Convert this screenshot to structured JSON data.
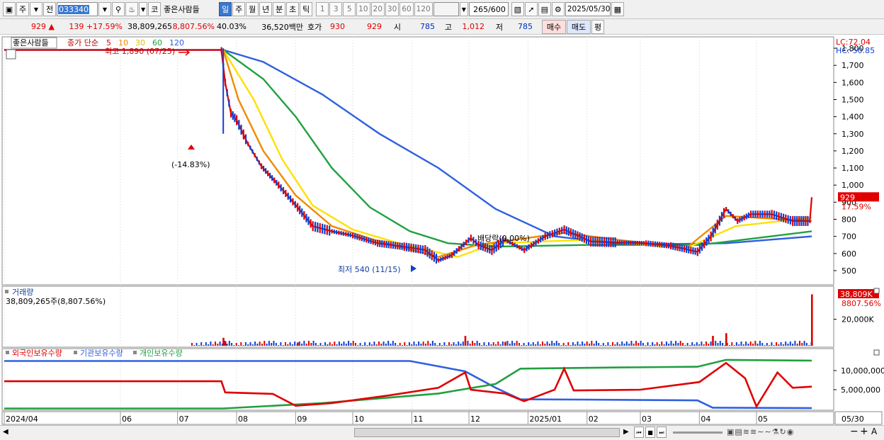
{
  "toolbar": {
    "market_label": "주",
    "prev_label": "전",
    "code": "033340",
    "market_tag": "코",
    "stock_name": "좋은사람들",
    "periods": [
      "일",
      "주",
      "월",
      "년",
      "분",
      "초",
      "틱"
    ],
    "active_period": "일",
    "intervals": [
      "1",
      "3",
      "5",
      "10",
      "20",
      "30",
      "60",
      "120"
    ],
    "count_value": "265",
    "count_total": "/600",
    "date_value": "2025/05/30"
  },
  "quote": {
    "price": "929",
    "change": "139",
    "change_pct": "+17.59%",
    "volume": "38,809,265",
    "volume_ratio": "8,807.56%",
    "turnover": "40.03%",
    "amount": "36,520백만",
    "ask_label": "호가",
    "ask": "930",
    "bid": "929",
    "open_label": "시",
    "open": "785",
    "high_label": "고",
    "high": "1,012",
    "low_label": "저",
    "low": "785",
    "buy_label": "매수",
    "sell_label": "매도",
    "eval_label": "평"
  },
  "price_panel": {
    "title_name": "좋은사람들",
    "legend_prefix": "종가 단순",
    "ma_periods": [
      "5",
      "10",
      "30",
      "60",
      "120"
    ],
    "ma_colors": [
      "#e00000",
      "#f08a00",
      "#ffe000",
      "#20a040",
      "#3060e0"
    ],
    "lc_label": "LC:72.04",
    "hc_label": "HC:-50.85",
    "high_annotation": "최고 1,890 (07/25)",
    "drop_annotation": "(-14.83%)",
    "low_annotation": "최저 540 (11/15)",
    "dividend_annotation": "배당락(0.00%)",
    "price_tag": "929",
    "pct_tag": "17.59%",
    "y_ticks": [
      "1,800",
      "1,700",
      "1,600",
      "1,500",
      "1,400",
      "1,300",
      "1,200",
      "1,100",
      "1,000",
      "900",
      "800",
      "700",
      "600",
      "500"
    ]
  },
  "volume_panel": {
    "title": "거래량",
    "value_label": "38,809,265주(8,807.56%)",
    "tag_value": "38,809K",
    "tag_pct": "8807.56%",
    "y_tick": "20,000K"
  },
  "holdings_panel": {
    "legend": [
      "외국인보유수량",
      "기관보유수량",
      "개인보유수량"
    ],
    "legend_colors": [
      "#e00000",
      "#3060e0",
      "#20a040"
    ],
    "y_ticks": [
      "10,000,000",
      "5,000,000"
    ]
  },
  "x_axis": {
    "labels": [
      "2024/04",
      "06",
      "07",
      "08",
      "09",
      "10",
      "11",
      "12",
      "2025/01",
      "02",
      "03",
      "04",
      "05"
    ],
    "end_label": "05/30"
  },
  "chart_data": {
    "type": "line",
    "price_range": [
      450,
      1850
    ],
    "price_series": [
      {
        "date": "2024/04/01",
        "close": 1790
      },
      {
        "date": "2024/07/24",
        "close": 1790
      },
      {
        "date": "2024/07/26",
        "close": 1600
      },
      {
        "date": "2024/07/29",
        "close": 1420
      },
      {
        "date": "2024/08/01",
        "close": 1380
      },
      {
        "date": "2024/08/07",
        "close": 1240
      },
      {
        "date": "2024/08/14",
        "close": 1110
      },
      {
        "date": "2024/08/23",
        "close": 1000
      },
      {
        "date": "2024/09/02",
        "close": 870
      },
      {
        "date": "2024/09/10",
        "close": 760
      },
      {
        "date": "2024/09/20",
        "close": 730
      },
      {
        "date": "2024/10/01",
        "close": 705
      },
      {
        "date": "2024/10/14",
        "close": 660
      },
      {
        "date": "2024/10/28",
        "close": 640
      },
      {
        "date": "2024/11/08",
        "close": 620
      },
      {
        "date": "2024/11/15",
        "close": 560
      },
      {
        "date": "2024/11/22",
        "close": 590
      },
      {
        "date": "2024/12/02",
        "close": 690
      },
      {
        "date": "2024/12/06",
        "close": 650
      },
      {
        "date": "2024/12/13",
        "close": 620
      },
      {
        "date": "2024/12/20",
        "close": 680
      },
      {
        "date": "2024/12/30",
        "close": 620
      },
      {
        "date": "2025/01/10",
        "close": 700
      },
      {
        "date": "2025/01/20",
        "close": 740
      },
      {
        "date": "2025/02/03",
        "close": 670
      },
      {
        "date": "2025/02/17",
        "close": 665
      },
      {
        "date": "2025/03/04",
        "close": 660
      },
      {
        "date": "2025/03/17",
        "close": 645
      },
      {
        "date": "2025/03/31",
        "close": 610
      },
      {
        "date": "2025/04/07",
        "close": 700
      },
      {
        "date": "2025/04/15",
        "close": 860
      },
      {
        "date": "2025/04/21",
        "close": 790
      },
      {
        "date": "2025/04/28",
        "close": 830
      },
      {
        "date": "2025/05/09",
        "close": 830
      },
      {
        "date": "2025/05/20",
        "close": 790
      },
      {
        "date": "2025/05/29",
        "close": 790
      },
      {
        "date": "2025/05/30",
        "close": 929
      }
    ],
    "ma120": [
      {
        "date": "2024/04/01",
        "value": 1790
      },
      {
        "date": "2024/07/25",
        "value": 1790
      },
      {
        "date": "2024/08/15",
        "value": 1720
      },
      {
        "date": "2024/09/15",
        "value": 1530
      },
      {
        "date": "2024/10/15",
        "value": 1300
      },
      {
        "date": "2024/11/15",
        "value": 1100
      },
      {
        "date": "2024/12/15",
        "value": 860
      },
      {
        "date": "2025/01/15",
        "value": 700
      },
      {
        "date": "2025/02/15",
        "value": 660
      },
      {
        "date": "2025/03/15",
        "value": 655
      },
      {
        "date": "2025/04/15",
        "value": 660
      },
      {
        "date": "2025/05/30",
        "value": 700
      }
    ],
    "ma60": [
      {
        "date": "2024/07/25",
        "value": 1790
      },
      {
        "date": "2024/08/15",
        "value": 1620
      },
      {
        "date": "2024/09/01",
        "value": 1400
      },
      {
        "date": "2024/09/20",
        "value": 1100
      },
      {
        "date": "2024/10/10",
        "value": 870
      },
      {
        "date": "2024/10/31",
        "value": 730
      },
      {
        "date": "2024/11/20",
        "value": 660
      },
      {
        "date": "2024/12/15",
        "value": 640
      },
      {
        "date": "2025/02/01",
        "value": 650
      },
      {
        "date": "2025/04/01",
        "value": 650
      },
      {
        "date": "2025/05/01",
        "value": 690
      },
      {
        "date": "2025/05/30",
        "value": 730
      }
    ],
    "ma30": [
      {
        "date": "2024/07/25",
        "value": 1790
      },
      {
        "date": "2024/08/10",
        "value": 1500
      },
      {
        "date": "2024/08/25",
        "value": 1150
      },
      {
        "date": "2024/09/10",
        "value": 880
      },
      {
        "date": "2024/10/01",
        "value": 740
      },
      {
        "date": "2024/10/25",
        "value": 660
      },
      {
        "date": "2024/11/25",
        "value": 580
      },
      {
        "date": "2024/12/15",
        "value": 660
      },
      {
        "date": "2025/02/01",
        "value": 680
      },
      {
        "date": "2025/03/25",
        "value": 630
      },
      {
        "date": "2025/04/20",
        "value": 760
      },
      {
        "date": "2025/05/30",
        "value": 810
      }
    ],
    "ma10": [
      {
        "date": "2024/07/25",
        "value": 1790
      },
      {
        "date": "2024/08/02",
        "value": 1500
      },
      {
        "date": "2024/08/15",
        "value": 1200
      },
      {
        "date": "2024/09/01",
        "value": 940
      },
      {
        "date": "2024/09/20",
        "value": 760
      },
      {
        "date": "2024/10/15",
        "value": 670
      },
      {
        "date": "2024/11/15",
        "value": 580
      },
      {
        "date": "2024/12/05",
        "value": 650
      },
      {
        "date": "2025/01/20",
        "value": 720
      },
      {
        "date": "2025/03/25",
        "value": 630
      },
      {
        "date": "2025/04/15",
        "value": 820
      },
      {
        "date": "2025/05/30",
        "value": 790
      }
    ],
    "volume_max_k": 38809,
    "volume_series": [
      {
        "date": "2024/07/25",
        "value_k": 6000
      },
      {
        "date": "2024/07/26",
        "value_k": 3500
      },
      {
        "date": "2024/09/02",
        "value_k": 2500
      },
      {
        "date": "2024/11/29",
        "value_k": 7500
      },
      {
        "date": "2024/12/20",
        "value_k": 3000
      },
      {
        "date": "2025/04/08",
        "value_k": 7500
      },
      {
        "date": "2025/04/15",
        "value_k": 9500
      },
      {
        "date": "2025/05/30",
        "value_k": 38809
      }
    ],
    "holdings_range": [
      0,
      15000000
    ],
    "foreign": [
      {
        "date": "2024/04/01",
        "value": 7200000
      },
      {
        "date": "2024/07/24",
        "value": 7200000
      },
      {
        "date": "2024/07/26",
        "value": 4300000
      },
      {
        "date": "2024/08/20",
        "value": 3900000
      },
      {
        "date": "2024/09/01",
        "value": 800000
      },
      {
        "date": "2024/09/20",
        "value": 1500000
      },
      {
        "date": "2024/10/20",
        "value": 3500000
      },
      {
        "date": "2024/11/15",
        "value": 5500000
      },
      {
        "date": "2024/11/29",
        "value": 9500000
      },
      {
        "date": "2024/12/02",
        "value": 5000000
      },
      {
        "date": "2024/12/20",
        "value": 4000000
      },
      {
        "date": "2024/12/30",
        "value": 2000000
      },
      {
        "date": "2025/01/15",
        "value": 5000000
      },
      {
        "date": "2025/01/20",
        "value": 10500000
      },
      {
        "date": "2025/01/25",
        "value": 4800000
      },
      {
        "date": "2025/03/01",
        "value": 5000000
      },
      {
        "date": "2025/04/01",
        "value": 7000000
      },
      {
        "date": "2025/04/15",
        "value": 12000000
      },
      {
        "date": "2025/04/25",
        "value": 8000000
      },
      {
        "date": "2025/05/01",
        "value": 600000
      },
      {
        "date": "2025/05/12",
        "value": 9500000
      },
      {
        "date": "2025/05/20",
        "value": 5500000
      },
      {
        "date": "2025/05/30",
        "value": 5800000
      }
    ],
    "institution": [
      {
        "date": "2024/04/01",
        "value": 12500000
      },
      {
        "date": "2024/10/31",
        "value": 12500000
      },
      {
        "date": "2024/11/29",
        "value": 9800000
      },
      {
        "date": "2024/12/15",
        "value": 5500000
      },
      {
        "date": "2024/12/28",
        "value": 2500000
      },
      {
        "date": "2025/01/31",
        "value": 2400000
      },
      {
        "date": "2025/03/31",
        "value": 2200000
      },
      {
        "date": "2025/04/08",
        "value": 300000
      },
      {
        "date": "2025/05/30",
        "value": 200000
      }
    ],
    "individual": [
      {
        "date": "2024/04/01",
        "value": 100000
      },
      {
        "date": "2024/07/25",
        "value": 100000
      },
      {
        "date": "2024/09/15",
        "value": 1500000
      },
      {
        "date": "2024/11/15",
        "value": 4000000
      },
      {
        "date": "2024/12/15",
        "value": 6500000
      },
      {
        "date": "2024/12/28",
        "value": 10500000
      },
      {
        "date": "2025/02/15",
        "value": 10800000
      },
      {
        "date": "2025/03/31",
        "value": 11000000
      },
      {
        "date": "2025/04/15",
        "value": 12800000
      },
      {
        "date": "2025/05/30",
        "value": 12600000
      }
    ]
  }
}
